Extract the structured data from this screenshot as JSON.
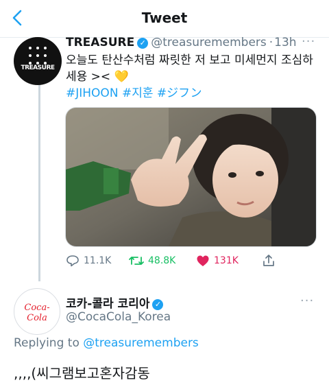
{
  "header": {
    "title": "Tweet"
  },
  "tweet": {
    "author_name": "TREASURE",
    "avatar_logo_text": "TREASURE",
    "handle": "@treasuremembers",
    "separator": "·",
    "time": "13h",
    "more": "···",
    "text": "오늘도 탄산수처럼 짜릿한 저 보고 미세먼지 조심하세용 >< 💛",
    "hashtags": [
      "#JIHOON",
      "#지훈",
      "#ジフン"
    ],
    "stats": {
      "replies": "11.1K",
      "retweets": "48.8K",
      "likes": "131K"
    },
    "colors": {
      "retweet": "#17bf63",
      "like": "#e0245e",
      "link": "#1da1f2"
    }
  },
  "reply": {
    "author_name": "코카-콜라 코리아",
    "avatar_logo_text": "Coca-Cola",
    "handle": "@CocaCola_Korea",
    "more": "···",
    "replying_label": "Replying to",
    "replying_to": "@treasuremembers",
    "text": ",,,,(씨그램보고혼자감동"
  }
}
